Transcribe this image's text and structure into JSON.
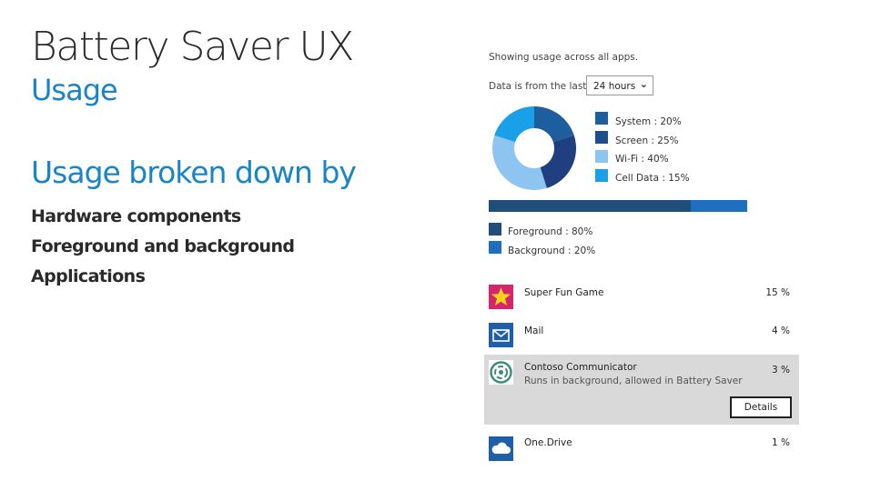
{
  "header": {
    "title": "Battery Saver UX",
    "subtitle": "Usage"
  },
  "breakdown": {
    "heading": "Usage broken down by",
    "items": [
      "Hardware components",
      "Foreground and background",
      "Applications"
    ]
  },
  "usage_panel": {
    "showing_text": "Showing usage across all apps.",
    "data_from_label": "Data is from the last:",
    "period_select": {
      "value": "24 hours"
    }
  },
  "components": {
    "legend": [
      {
        "label": "System : 20%",
        "color": "#1d5f9e"
      },
      {
        "label": "Screen : 25%",
        "color": "#1f4e8c"
      },
      {
        "label": "Wi-Fi : 40%",
        "color": "#8ec4f0"
      },
      {
        "label": "Cell Data : 15%",
        "color": "#1aa0e8"
      }
    ]
  },
  "fg_bg": {
    "legend": [
      {
        "label": "Foreground : 80%",
        "color": "#1f4e7a"
      },
      {
        "label": "Background : 20%",
        "color": "#1e6fbd"
      }
    ]
  },
  "apps": [
    {
      "name": "Super Fun Game",
      "percent": "15 %",
      "icon": "star-icon"
    },
    {
      "name": "Mail",
      "percent": "4 %",
      "icon": "mail-icon"
    },
    {
      "name": "Contoso Communicator",
      "subtitle": "Runs in background, allowed in Battery Saver",
      "percent": "3 %",
      "icon": "communicator-icon",
      "details_label": "Details"
    },
    {
      "name": "One.Drive",
      "percent": "1 %",
      "icon": "cloud-icon"
    }
  ]
}
